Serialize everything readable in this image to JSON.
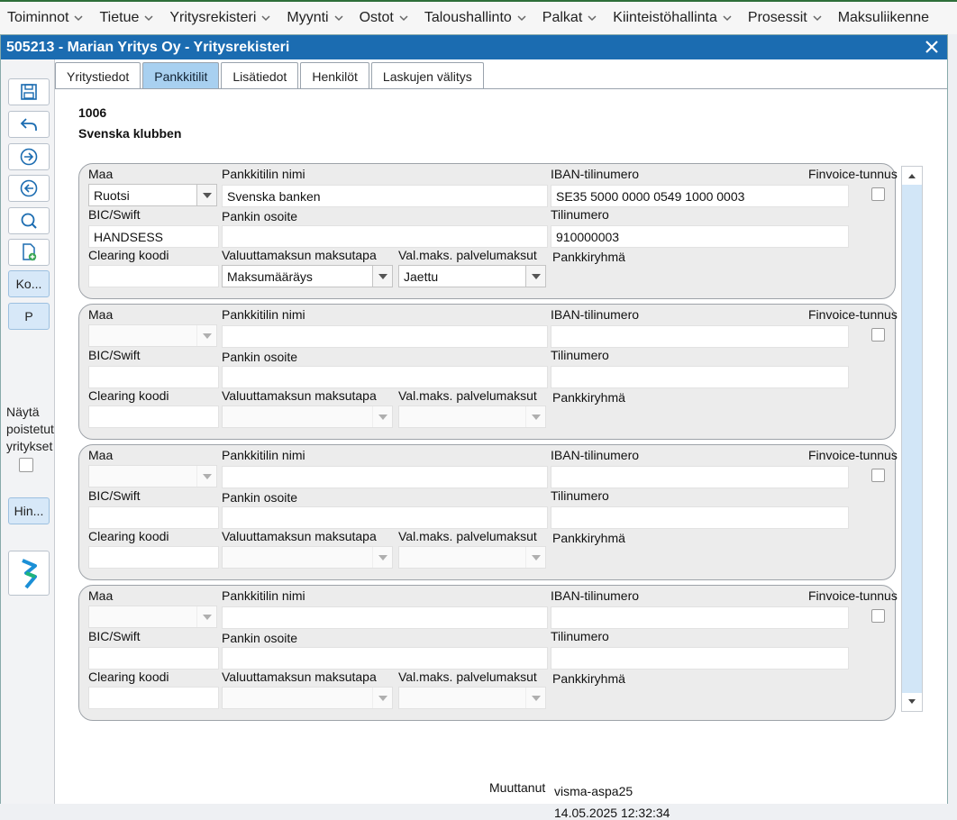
{
  "menu": [
    {
      "label": "Toiminnot"
    },
    {
      "label": "Tietue"
    },
    {
      "label": "Yritysrekisteri"
    },
    {
      "label": "Myynti"
    },
    {
      "label": "Ostot"
    },
    {
      "label": "Taloushallinto"
    },
    {
      "label": "Palkat"
    },
    {
      "label": "Kiinteistöhallinta"
    },
    {
      "label": "Prosessit"
    },
    {
      "label": "Maksuliikenne"
    }
  ],
  "window": {
    "title": "505213 - Marian Yritys Oy - Yritysrekisteri"
  },
  "left_tools": {
    "ko_label": "Ko...",
    "p_label": "P",
    "show_deleted_label": "Näytä poistetut yritykset",
    "hin_label": "Hin..."
  },
  "tabs": [
    {
      "label": "Yritystiedot",
      "active": false
    },
    {
      "label": "Pankkitilit",
      "active": true
    },
    {
      "label": "Lisätiedot",
      "active": false
    },
    {
      "label": "Henkilöt",
      "active": false
    },
    {
      "label": "Laskujen välitys",
      "active": false
    }
  ],
  "company": {
    "id": "1006",
    "name": "Svenska klubben"
  },
  "labels": {
    "maa": "Maa",
    "pankkitilin_nimi": "Pankkitilin nimi",
    "iban": "IBAN-tilinumero",
    "finvoice": "Finvoice-tunnus",
    "bic": "BIC/Swift",
    "pankin_osoite": "Pankin osoite",
    "tilinumero": "Tilinumero",
    "clearing": "Clearing koodi",
    "valuutta_maksutapa": "Valuuttamaksun maksutapa",
    "palvelumaksut": "Val.maks. palvelumaksut",
    "pankkiryhma": "Pankkiryhmä"
  },
  "accounts": [
    {
      "maa": "Ruotsi",
      "nimi": "Svenska banken",
      "iban": "SE35 5000 0000 0549 1000 0003",
      "bic": "HANDSESS",
      "osoite": "",
      "tilinumero": "910000003",
      "clearing": "",
      "maksutapa": "Maksumääräys",
      "palvelumaksut": "Jaettu",
      "finvoice": false,
      "enabled": true
    },
    {
      "maa": "",
      "nimi": "",
      "iban": "",
      "bic": "",
      "osoite": "",
      "tilinumero": "",
      "clearing": "",
      "maksutapa": "",
      "palvelumaksut": "",
      "finvoice": false,
      "enabled": false
    },
    {
      "maa": "",
      "nimi": "",
      "iban": "",
      "bic": "",
      "osoite": "",
      "tilinumero": "",
      "clearing": "",
      "maksutapa": "",
      "palvelumaksut": "",
      "finvoice": false,
      "enabled": false
    },
    {
      "maa": "",
      "nimi": "",
      "iban": "",
      "bic": "",
      "osoite": "",
      "tilinumero": "",
      "clearing": "",
      "maksutapa": "",
      "palvelumaksut": "",
      "finvoice": false,
      "enabled": false
    }
  ],
  "footer": {
    "modified_label": "Muuttanut",
    "modified_by": "visma-aspa25",
    "modified_at": "14.05.2025 12:32:34"
  },
  "colors": {
    "titlebar": "#1b6cb1",
    "active_tab": "#a8d0f0",
    "group_bg": "#ececec"
  }
}
